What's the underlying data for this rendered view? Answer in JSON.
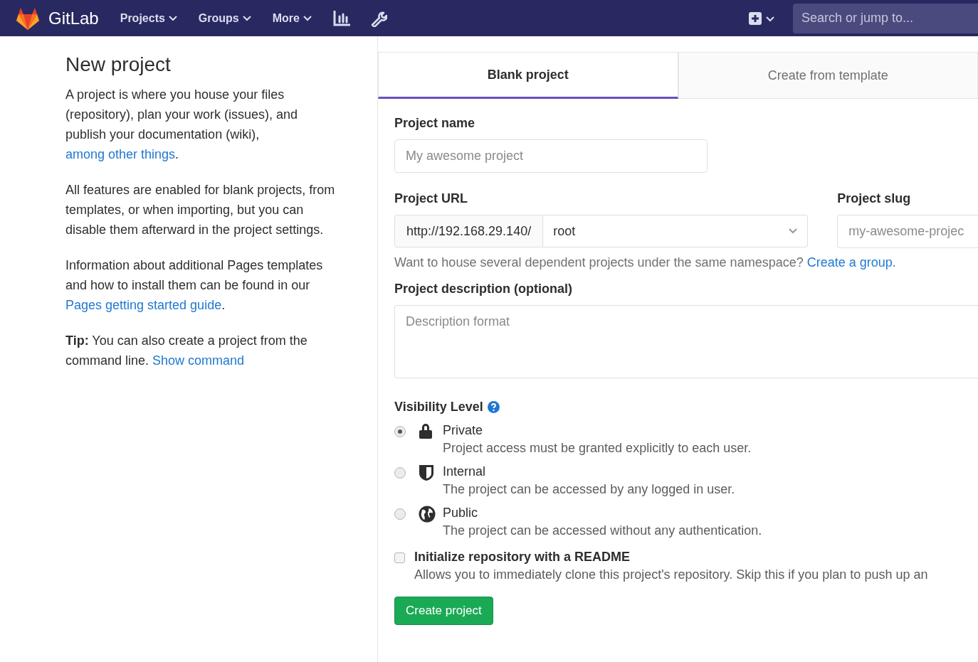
{
  "navbar": {
    "brand": "GitLab",
    "menus": [
      {
        "label": "Projects"
      },
      {
        "label": "Groups"
      },
      {
        "label": "More"
      }
    ],
    "search": {
      "placeholder": "Search or jump to..."
    }
  },
  "intro": {
    "title": "New project",
    "paragraphs": [
      {
        "text": "A project is where you house your files (repository), plan your work (issues), and publish your documentation (wiki), ",
        "link": "among other things",
        "after": "."
      },
      {
        "text": "All features are enabled for blank projects, from templates, or when importing, but you can disable them afterward in the project settings."
      },
      {
        "text": "Information about additional Pages templates and how to install them can be found in our ",
        "link": "Pages getting started guide",
        "after": "."
      },
      {
        "text": "**Tip:** You can also create a project from the command line. ",
        "link": "Show command"
      }
    ]
  },
  "tabs": [
    {
      "label": "Blank project",
      "selected": true
    },
    {
      "label": "Create from template",
      "selected": false
    }
  ],
  "form": {
    "name_label": "Project name",
    "name_placeholder": "My awesome project",
    "url_label": "Project URL",
    "url_prefix": "http://192.168.29.140/",
    "namespace": "root",
    "slug_label": "Project slug",
    "slug_placeholder": "my-awesome-projec",
    "namespace_hint": "Want to house several dependent projects under the same namespace? ",
    "namespace_link": "Create a group.",
    "description_label": "Project description (optional)",
    "description_placeholder": "Description format",
    "visibility_label": "Visibility Level",
    "visibility": [
      {
        "kind": "lock",
        "label": "Private",
        "description": "Project access must be granted explicitly to each user.",
        "selected": true
      },
      {
        "kind": "shield",
        "label": "Internal",
        "description": "The project can be accessed by any logged in user.",
        "selected": false
      },
      {
        "kind": "globe",
        "label": "Public",
        "description": "The project can be accessed without any authentication.",
        "selected": false
      }
    ],
    "readme": {
      "label": "Initialize repository with a README",
      "description": "Allows you to immediately clone this project's repository. Skip this if you plan to push up an",
      "checked": false
    },
    "submit": "Create project"
  }
}
